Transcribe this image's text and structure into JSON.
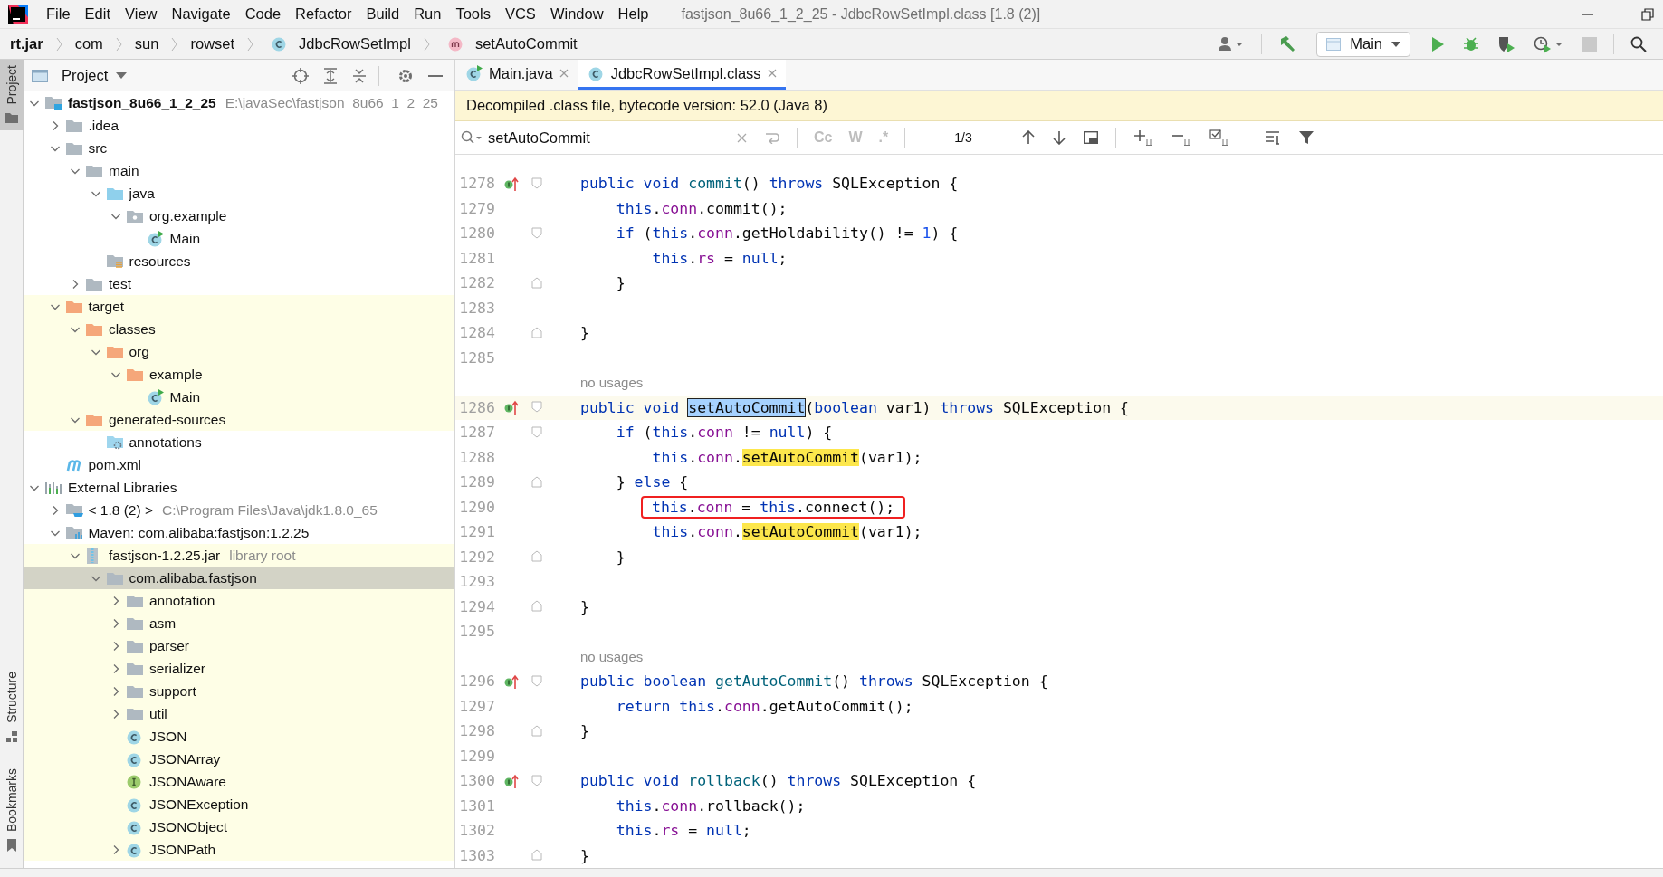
{
  "menu": [
    "File",
    "Edit",
    "View",
    "Navigate",
    "Code",
    "Refactor",
    "Build",
    "Run",
    "Tools",
    "VCS",
    "Window",
    "Help"
  ],
  "window": {
    "title": "fastjson_8u66_1_2_25 - JdbcRowSetImpl.class [1.8 (2)]"
  },
  "breadcrumbs": [
    {
      "label": "rt.jar",
      "kind": "jar"
    },
    {
      "label": "com",
      "kind": "package"
    },
    {
      "label": "sun",
      "kind": "package"
    },
    {
      "label": "rowset",
      "kind": "package"
    },
    {
      "label": "JdbcRowSetImpl",
      "kind": "class"
    },
    {
      "label": "setAutoCommit",
      "kind": "method"
    }
  ],
  "toolbar": {
    "run_config": "Main"
  },
  "tool_windows_top": [
    {
      "label": "Project",
      "selected": true
    }
  ],
  "tool_windows_bottom": [
    {
      "label": "Structure",
      "kind": "structure",
      "selected": false
    },
    {
      "label": "Bookmarks",
      "kind": "bookmarks",
      "selected": false
    }
  ],
  "project": {
    "title": "Project",
    "tree": [
      {
        "label": "fastjson_8u66_1_2_25",
        "secondary": "E:\\javaSec\\fastjson_8u66_1_2_25",
        "kind": "module",
        "expanded": true,
        "selected": false,
        "tinted": false,
        "children": [
          {
            "label": ".idea",
            "kind": "folder",
            "expanded": false,
            "selected": false,
            "tinted": false
          },
          {
            "label": "src",
            "kind": "folder",
            "expanded": true,
            "selected": false,
            "tinted": false,
            "children": [
              {
                "label": "main",
                "kind": "folder",
                "expanded": true,
                "selected": false,
                "tinted": false,
                "children": [
                  {
                    "label": "java",
                    "kind": "source-folder",
                    "expanded": true,
                    "selected": false,
                    "tinted": false,
                    "children": [
                      {
                        "label": "org.example",
                        "kind": "package",
                        "expanded": true,
                        "selected": false,
                        "tinted": false,
                        "children": [
                          {
                            "label": "Main",
                            "kind": "runnable-class",
                            "selected": false,
                            "tinted": false
                          }
                        ]
                      }
                    ]
                  },
                  {
                    "label": "resources",
                    "kind": "resources-folder",
                    "selected": false,
                    "tinted": false
                  }
                ]
              },
              {
                "label": "test",
                "kind": "folder",
                "expanded": false,
                "selected": false,
                "tinted": false
              }
            ]
          },
          {
            "label": "target",
            "kind": "excluded-folder",
            "expanded": true,
            "selected": false,
            "tinted": true,
            "children": [
              {
                "label": "classes",
                "kind": "excluded-folder",
                "expanded": true,
                "selected": false,
                "tinted": true,
                "children": [
                  {
                    "label": "org",
                    "kind": "excluded-folder",
                    "expanded": true,
                    "selected": false,
                    "tinted": true,
                    "children": [
                      {
                        "label": "example",
                        "kind": "excluded-folder",
                        "expanded": true,
                        "selected": false,
                        "tinted": true,
                        "children": [
                          {
                            "label": "Main",
                            "kind": "runnable-class",
                            "selected": false,
                            "tinted": true
                          }
                        ]
                      }
                    ]
                  }
                ]
              },
              {
                "label": "generated-sources",
                "kind": "excluded-folder",
                "expanded": true,
                "selected": false,
                "tinted": true,
                "children": [
                  {
                    "label": "annotations",
                    "kind": "generated-folder",
                    "selected": false,
                    "tinted": false
                  }
                ]
              }
            ]
          },
          {
            "label": "pom.xml",
            "kind": "maven-file",
            "selected": false,
            "tinted": false
          }
        ]
      },
      {
        "label": "External Libraries",
        "kind": "libraries",
        "expanded": true,
        "selected": false,
        "tinted": false,
        "children": [
          {
            "label": "< 1.8 (2) >",
            "secondary": "C:\\Program Files\\Java\\jdk1.8.0_65",
            "kind": "jdk",
            "expanded": false,
            "selected": false,
            "tinted": false
          },
          {
            "label": "Maven: com.alibaba:fastjson:1.2.25",
            "kind": "maven-library",
            "expanded": true,
            "selected": false,
            "tinted": false,
            "children": [
              {
                "label": "fastjson-1.2.25.jar",
                "secondary": "library root",
                "kind": "jar",
                "expanded": true,
                "selected": false,
                "tinted": true,
                "children": [
                  {
                    "label": "com.alibaba.fastjson",
                    "kind": "folder",
                    "expanded": true,
                    "selected": true,
                    "tinted": true,
                    "children": [
                      {
                        "label": "annotation",
                        "kind": "folder",
                        "expanded": false,
                        "selected": false,
                        "tinted": true
                      },
                      {
                        "label": "asm",
                        "kind": "folder",
                        "expanded": false,
                        "selected": false,
                        "tinted": true
                      },
                      {
                        "label": "parser",
                        "kind": "folder",
                        "expanded": false,
                        "selected": false,
                        "tinted": true
                      },
                      {
                        "label": "serializer",
                        "kind": "folder",
                        "expanded": false,
                        "selected": false,
                        "tinted": true
                      },
                      {
                        "label": "support",
                        "kind": "folder",
                        "expanded": false,
                        "selected": false,
                        "tinted": true
                      },
                      {
                        "label": "util",
                        "kind": "folder",
                        "expanded": false,
                        "selected": false,
                        "tinted": true
                      },
                      {
                        "label": "JSON",
                        "kind": "class",
                        "selected": false,
                        "tinted": true
                      },
                      {
                        "label": "JSONArray",
                        "kind": "class",
                        "selected": false,
                        "tinted": true
                      },
                      {
                        "label": "JSONAware",
                        "kind": "interface",
                        "selected": false,
                        "tinted": true
                      },
                      {
                        "label": "JSONException",
                        "kind": "class",
                        "selected": false,
                        "tinted": true
                      },
                      {
                        "label": "JSONObject",
                        "kind": "class",
                        "selected": false,
                        "tinted": true
                      },
                      {
                        "label": "JSONPath",
                        "kind": "class",
                        "expanded": false,
                        "selected": false,
                        "tinted": true
                      }
                    ]
                  }
                ]
              }
            ]
          }
        ]
      }
    ]
  },
  "editor": {
    "tabs": [
      {
        "label": "Main.java",
        "kind": "runnable-class",
        "selected": false
      },
      {
        "label": "JdbcRowSetImpl.class",
        "kind": "class",
        "selected": true
      }
    ],
    "banner": "Decompiled .class file, bytecode version: 52.0 (Java 8)",
    "search": {
      "value": "setAutoCommit",
      "options": [
        {
          "label": "Cc",
          "on": false
        },
        {
          "label": "W",
          "on": false
        },
        {
          "label": ".*",
          "on": false
        }
      ],
      "count": "1/3"
    },
    "lines": [
      {
        "number": "1278",
        "override": true,
        "fold_start": true,
        "fold_end": false,
        "current": false,
        "boxed": false,
        "segments": [
          {
            "text": "public void ",
            "kind": "kw"
          },
          {
            "text": "commit",
            "kind": "decl"
          },
          {
            "text": "() ",
            "kind": "plain"
          },
          {
            "text": "throws ",
            "kind": "kw"
          },
          {
            "text": "SQLException {",
            "kind": "plain"
          }
        ]
      },
      {
        "number": "1279",
        "override": false,
        "fold_start": false,
        "fold_end": false,
        "current": false,
        "boxed": false,
        "segments": [
          {
            "text": "    this",
            "kind": "kw"
          },
          {
            "text": ".",
            "kind": "plain"
          },
          {
            "text": "conn",
            "kind": "field"
          },
          {
            "text": ".commit();",
            "kind": "plain"
          }
        ]
      },
      {
        "number": "1280",
        "override": false,
        "fold_start": true,
        "fold_end": false,
        "current": false,
        "boxed": false,
        "segments": [
          {
            "text": "    if ",
            "kind": "kw"
          },
          {
            "text": "(",
            "kind": "plain"
          },
          {
            "text": "this",
            "kind": "kw"
          },
          {
            "text": ".",
            "kind": "plain"
          },
          {
            "text": "conn",
            "kind": "field"
          },
          {
            "text": ".getHoldability() != ",
            "kind": "plain"
          },
          {
            "text": "1",
            "kind": "num"
          },
          {
            "text": ") {",
            "kind": "plain"
          }
        ]
      },
      {
        "number": "1281",
        "override": false,
        "fold_start": false,
        "fold_end": false,
        "current": false,
        "boxed": false,
        "segments": [
          {
            "text": "        this",
            "kind": "kw"
          },
          {
            "text": ".",
            "kind": "plain"
          },
          {
            "text": "rs",
            "kind": "field"
          },
          {
            "text": " = ",
            "kind": "plain"
          },
          {
            "text": "null",
            "kind": "kw"
          },
          {
            "text": ";",
            "kind": "plain"
          }
        ]
      },
      {
        "number": "1282",
        "override": false,
        "fold_start": false,
        "fold_end": true,
        "current": false,
        "boxed": false,
        "segments": [
          {
            "text": "    }",
            "kind": "plain"
          }
        ]
      },
      {
        "number": "1283",
        "override": false,
        "fold_start": false,
        "fold_end": false,
        "current": false
      },
      {
        "number": "1284",
        "override": false,
        "fold_start": false,
        "fold_end": true,
        "current": false,
        "boxed": false,
        "segments": [
          {
            "text": "}",
            "kind": "plain"
          }
        ]
      },
      {
        "number": "1285",
        "override": false,
        "fold_start": false,
        "fold_end": false,
        "current": false
      },
      {
        "number": "1286",
        "inlay": "no usages",
        "override": true,
        "fold_start": true,
        "fold_end": false,
        "current": true,
        "boxed": false,
        "segments": [
          {
            "text": "public void ",
            "kind": "kw"
          },
          {
            "text": "setAutoCommit",
            "kind": "current-match"
          },
          {
            "text": "(",
            "kind": "plain"
          },
          {
            "text": "boolean ",
            "kind": "kw"
          },
          {
            "text": "var1) ",
            "kind": "plain"
          },
          {
            "text": "throws ",
            "kind": "kw"
          },
          {
            "text": "SQLException {",
            "kind": "plain"
          }
        ]
      },
      {
        "number": "1287",
        "override": false,
        "fold_start": true,
        "fold_end": false,
        "current": false,
        "boxed": false,
        "segments": [
          {
            "text": "    if ",
            "kind": "kw"
          },
          {
            "text": "(",
            "kind": "plain"
          },
          {
            "text": "this",
            "kind": "kw"
          },
          {
            "text": ".",
            "kind": "plain"
          },
          {
            "text": "conn",
            "kind": "field"
          },
          {
            "text": " != ",
            "kind": "plain"
          },
          {
            "text": "null",
            "kind": "kw"
          },
          {
            "text": ") {",
            "kind": "plain"
          }
        ]
      },
      {
        "number": "1288",
        "override": false,
        "fold_start": false,
        "fold_end": false,
        "current": false,
        "boxed": false,
        "segments": [
          {
            "text": "        this",
            "kind": "kw"
          },
          {
            "text": ".",
            "kind": "plain"
          },
          {
            "text": "conn",
            "kind": "field"
          },
          {
            "text": ".",
            "kind": "plain"
          },
          {
            "text": "setAutoCommit",
            "kind": "match"
          },
          {
            "text": "(var1);",
            "kind": "plain"
          }
        ]
      },
      {
        "number": "1289",
        "override": false,
        "fold_start": false,
        "fold_end": true,
        "current": false,
        "boxed": false,
        "segments": [
          {
            "text": "    } ",
            "kind": "plain"
          },
          {
            "text": "else ",
            "kind": "kw"
          },
          {
            "text": "{",
            "kind": "plain"
          }
        ]
      },
      {
        "number": "1290",
        "override": false,
        "fold_start": false,
        "fold_end": false,
        "current": false,
        "boxed": true,
        "segments": [
          {
            "text": "        this",
            "kind": "kw"
          },
          {
            "text": ".",
            "kind": "plain"
          },
          {
            "text": "conn",
            "kind": "field"
          },
          {
            "text": " = ",
            "kind": "plain"
          },
          {
            "text": "this",
            "kind": "kw"
          },
          {
            "text": ".connect();",
            "kind": "plain"
          }
        ]
      },
      {
        "number": "1291",
        "override": false,
        "fold_start": false,
        "fold_end": false,
        "current": false,
        "boxed": false,
        "segments": [
          {
            "text": "        this",
            "kind": "kw"
          },
          {
            "text": ".",
            "kind": "plain"
          },
          {
            "text": "conn",
            "kind": "field"
          },
          {
            "text": ".",
            "kind": "plain"
          },
          {
            "text": "setAutoCommit",
            "kind": "match"
          },
          {
            "text": "(var1);",
            "kind": "plain"
          }
        ]
      },
      {
        "number": "1292",
        "override": false,
        "fold_start": false,
        "fold_end": true,
        "current": false,
        "boxed": false,
        "segments": [
          {
            "text": "    }",
            "kind": "plain"
          }
        ]
      },
      {
        "number": "1293",
        "override": false,
        "fold_start": false,
        "fold_end": false,
        "current": false
      },
      {
        "number": "1294",
        "override": false,
        "fold_start": false,
        "fold_end": true,
        "current": false,
        "boxed": false,
        "segments": [
          {
            "text": "}",
            "kind": "plain"
          }
        ]
      },
      {
        "number": "1295",
        "override": false,
        "fold_start": false,
        "fold_end": false,
        "current": false
      },
      {
        "number": "1296",
        "inlay": "no usages",
        "override": true,
        "fold_start": true,
        "fold_end": false,
        "current": false,
        "boxed": false,
        "segments": [
          {
            "text": "public boolean ",
            "kind": "kw"
          },
          {
            "text": "getAutoCommit",
            "kind": "decl"
          },
          {
            "text": "() ",
            "kind": "plain"
          },
          {
            "text": "throws ",
            "kind": "kw"
          },
          {
            "text": "SQLException {",
            "kind": "plain"
          }
        ]
      },
      {
        "number": "1297",
        "override": false,
        "fold_start": false,
        "fold_end": false,
        "current": false,
        "boxed": false,
        "segments": [
          {
            "text": "    return this",
            "kind": "kw"
          },
          {
            "text": ".",
            "kind": "plain"
          },
          {
            "text": "conn",
            "kind": "field"
          },
          {
            "text": ".getAutoCommit();",
            "kind": "plain"
          }
        ]
      },
      {
        "number": "1298",
        "override": false,
        "fold_start": false,
        "fold_end": true,
        "current": false,
        "boxed": false,
        "segments": [
          {
            "text": "}",
            "kind": "plain"
          }
        ]
      },
      {
        "number": "1299",
        "override": false,
        "fold_start": false,
        "fold_end": false,
        "current": false
      },
      {
        "number": "1300",
        "override": true,
        "fold_start": true,
        "fold_end": false,
        "current": false,
        "boxed": false,
        "segments": [
          {
            "text": "public void ",
            "kind": "kw"
          },
          {
            "text": "rollback",
            "kind": "decl"
          },
          {
            "text": "() ",
            "kind": "plain"
          },
          {
            "text": "throws ",
            "kind": "kw"
          },
          {
            "text": "SQLException {",
            "kind": "plain"
          }
        ]
      },
      {
        "number": "1301",
        "override": false,
        "fold_start": false,
        "fold_end": false,
        "current": false,
        "boxed": false,
        "segments": [
          {
            "text": "    this",
            "kind": "kw"
          },
          {
            "text": ".",
            "kind": "plain"
          },
          {
            "text": "conn",
            "kind": "field"
          },
          {
            "text": ".rollback();",
            "kind": "plain"
          }
        ]
      },
      {
        "number": "1302",
        "override": false,
        "fold_start": false,
        "fold_end": false,
        "current": false,
        "boxed": false,
        "segments": [
          {
            "text": "    this",
            "kind": "kw"
          },
          {
            "text": ".",
            "kind": "plain"
          },
          {
            "text": "rs",
            "kind": "field"
          },
          {
            "text": " = ",
            "kind": "plain"
          },
          {
            "text": "null",
            "kind": "kw"
          },
          {
            "text": ";",
            "kind": "plain"
          }
        ]
      },
      {
        "number": "1303",
        "override": false,
        "fold_start": false,
        "fold_end": true,
        "current": false,
        "boxed": false,
        "segments": [
          {
            "text": "}",
            "kind": "plain"
          }
        ]
      }
    ]
  }
}
